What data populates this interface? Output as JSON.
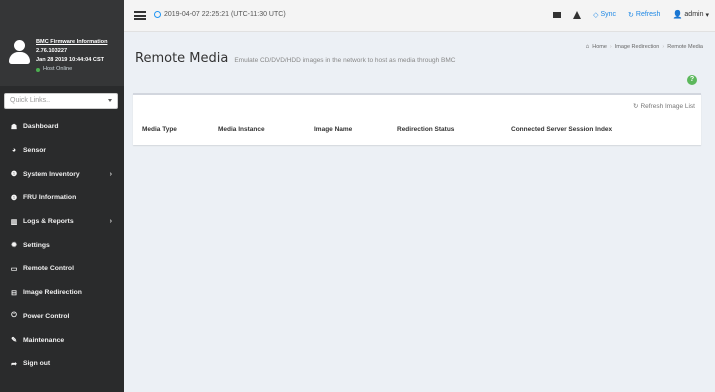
{
  "sidebar": {
    "firmware_title": "BMC Firmware Information",
    "firmware_version": "2.76.103227",
    "firmware_date": "Jan 28 2019 10:44:04 CST",
    "host_status": "Host Online",
    "quicklinks_placeholder": "Quick Links..",
    "items": [
      {
        "label": "Dashboard",
        "icon": "dashboard-icon",
        "glyph": "☗",
        "submenu": false
      },
      {
        "label": "Sensor",
        "icon": "sensor-icon",
        "glyph": "◕",
        "submenu": false
      },
      {
        "label": "System Inventory",
        "icon": "info-icon",
        "glyph": "❶",
        "submenu": true
      },
      {
        "label": "FRU Information",
        "icon": "info-icon",
        "glyph": "❶",
        "submenu": false
      },
      {
        "label": "Logs & Reports",
        "icon": "chart-icon",
        "glyph": "▥",
        "submenu": true
      },
      {
        "label": "Settings",
        "icon": "gear-icon",
        "glyph": "✹",
        "submenu": false
      },
      {
        "label": "Remote Control",
        "icon": "monitor-icon",
        "glyph": "▭",
        "submenu": false
      },
      {
        "label": "Image Redirection",
        "icon": "disk-icon",
        "glyph": "⊟",
        "submenu": false
      },
      {
        "label": "Power Control",
        "icon": "power-icon",
        "glyph": "⏻",
        "submenu": false
      },
      {
        "label": "Maintenance",
        "icon": "wrench-icon",
        "glyph": "✎",
        "submenu": false
      },
      {
        "label": "Sign out",
        "icon": "sign-out-icon",
        "glyph": "➦",
        "submenu": false
      }
    ]
  },
  "topbar": {
    "datetime": "2019-04-07 22:25:21 (UTC-11:30 UTC)",
    "sync_label": "Sync",
    "refresh_label": "Refresh",
    "user_label": "admin"
  },
  "page": {
    "title": "Remote Media",
    "subtitle": "Emulate CD/DVD/HDD images in the network to host as media through BMC",
    "breadcrumb": [
      "Home",
      "Image Redirection",
      "Remote Media"
    ],
    "help_label": "?"
  },
  "media_box": {
    "refresh_list_label": "Refresh Image List",
    "columns": [
      "Media Type",
      "Media Instance",
      "Image Name",
      "Redirection Status",
      "Connected Server Session Index"
    ],
    "rows": []
  },
  "colors": {
    "sidebar_bg": "#2a2b2c",
    "accent_blue": "#1e88e5",
    "online_green": "#4caf50",
    "help_green": "#5cb85c"
  }
}
